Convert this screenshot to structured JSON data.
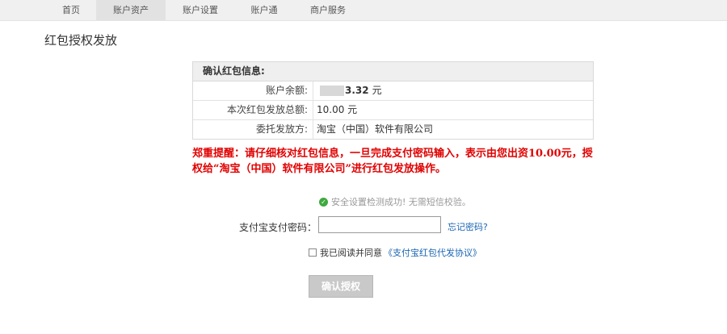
{
  "nav": {
    "items": [
      {
        "label": "首页"
      },
      {
        "label": "账户资产"
      },
      {
        "label": "账户设置"
      },
      {
        "label": "账户通"
      },
      {
        "label": "商户服务"
      }
    ]
  },
  "page": {
    "title": "红包授权发放"
  },
  "info": {
    "header": "确认红包信息:",
    "balance_label": "账户余额:",
    "balance_value": "3.32",
    "balance_unit": "元",
    "total_label": "本次红包发放总额:",
    "total_value": "10.00 元",
    "delegator_label": "委托发放方:",
    "delegator_value": "淘宝（中国）软件有限公司"
  },
  "warning": {
    "text": "郑重提醒：请仔细核对红包信息，一旦完成支付密码输入，表示由您出资10.00元，授权给“淘宝（中国）软件有限公司”进行红包发放操作。"
  },
  "security": {
    "text": "安全设置检测成功! 无需短信校验。"
  },
  "password": {
    "label": "支付宝支付密码：",
    "value": "",
    "forgot_label": "忘记密码?"
  },
  "agreement": {
    "text": "我已阅读并同意",
    "link_label": "《支付宝红包代发协议》",
    "checked": false
  },
  "confirm": {
    "label": "确认授权"
  }
}
